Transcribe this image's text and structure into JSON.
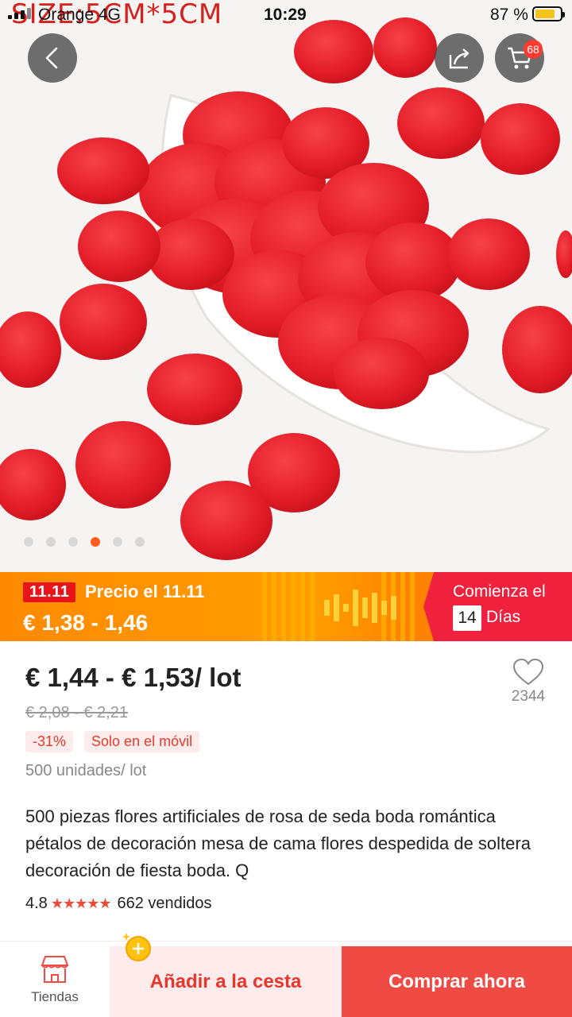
{
  "image_overlay": {
    "size_text": "SIZE:5CM*5CM"
  },
  "status_bar": {
    "carrier": "Orange 4G",
    "time": "10:29",
    "battery": "87 %"
  },
  "header": {
    "cart_count": "68"
  },
  "carousel": {
    "dot_count": 6,
    "active_index": 3
  },
  "promo": {
    "tag": "11.11",
    "title": "Precio el 11.11",
    "price": "€ 1,38 - 1,46",
    "countdown_label": "Comienza el",
    "countdown_value": "14",
    "countdown_unit": "Días"
  },
  "product": {
    "price": "€ 1,44 - € 1,53/ lot",
    "original_price": "€ 2,08 - € 2,21",
    "discount_badge": "-31%",
    "mobile_badge": "Solo en el móvil",
    "units": "500 unidades/ lot",
    "wishlist_count": "2344",
    "title": "500 piezas flores artificiales de rosa de seda boda romántica pétalos de decoración mesa de cama flores despedida de soltera decoración de fiesta boda. Q",
    "rating": "4.8",
    "stars": "★★★★★",
    "sold": "662 vendidos"
  },
  "bottom_bar": {
    "stores_label": "Tiendas",
    "add_to_cart": "Añadir a la cesta",
    "buy_now": "Comprar ahora"
  },
  "colors": {
    "accent": "#f04a45",
    "promo_orange": "#ff9400",
    "promo_red": "#f0213d"
  }
}
